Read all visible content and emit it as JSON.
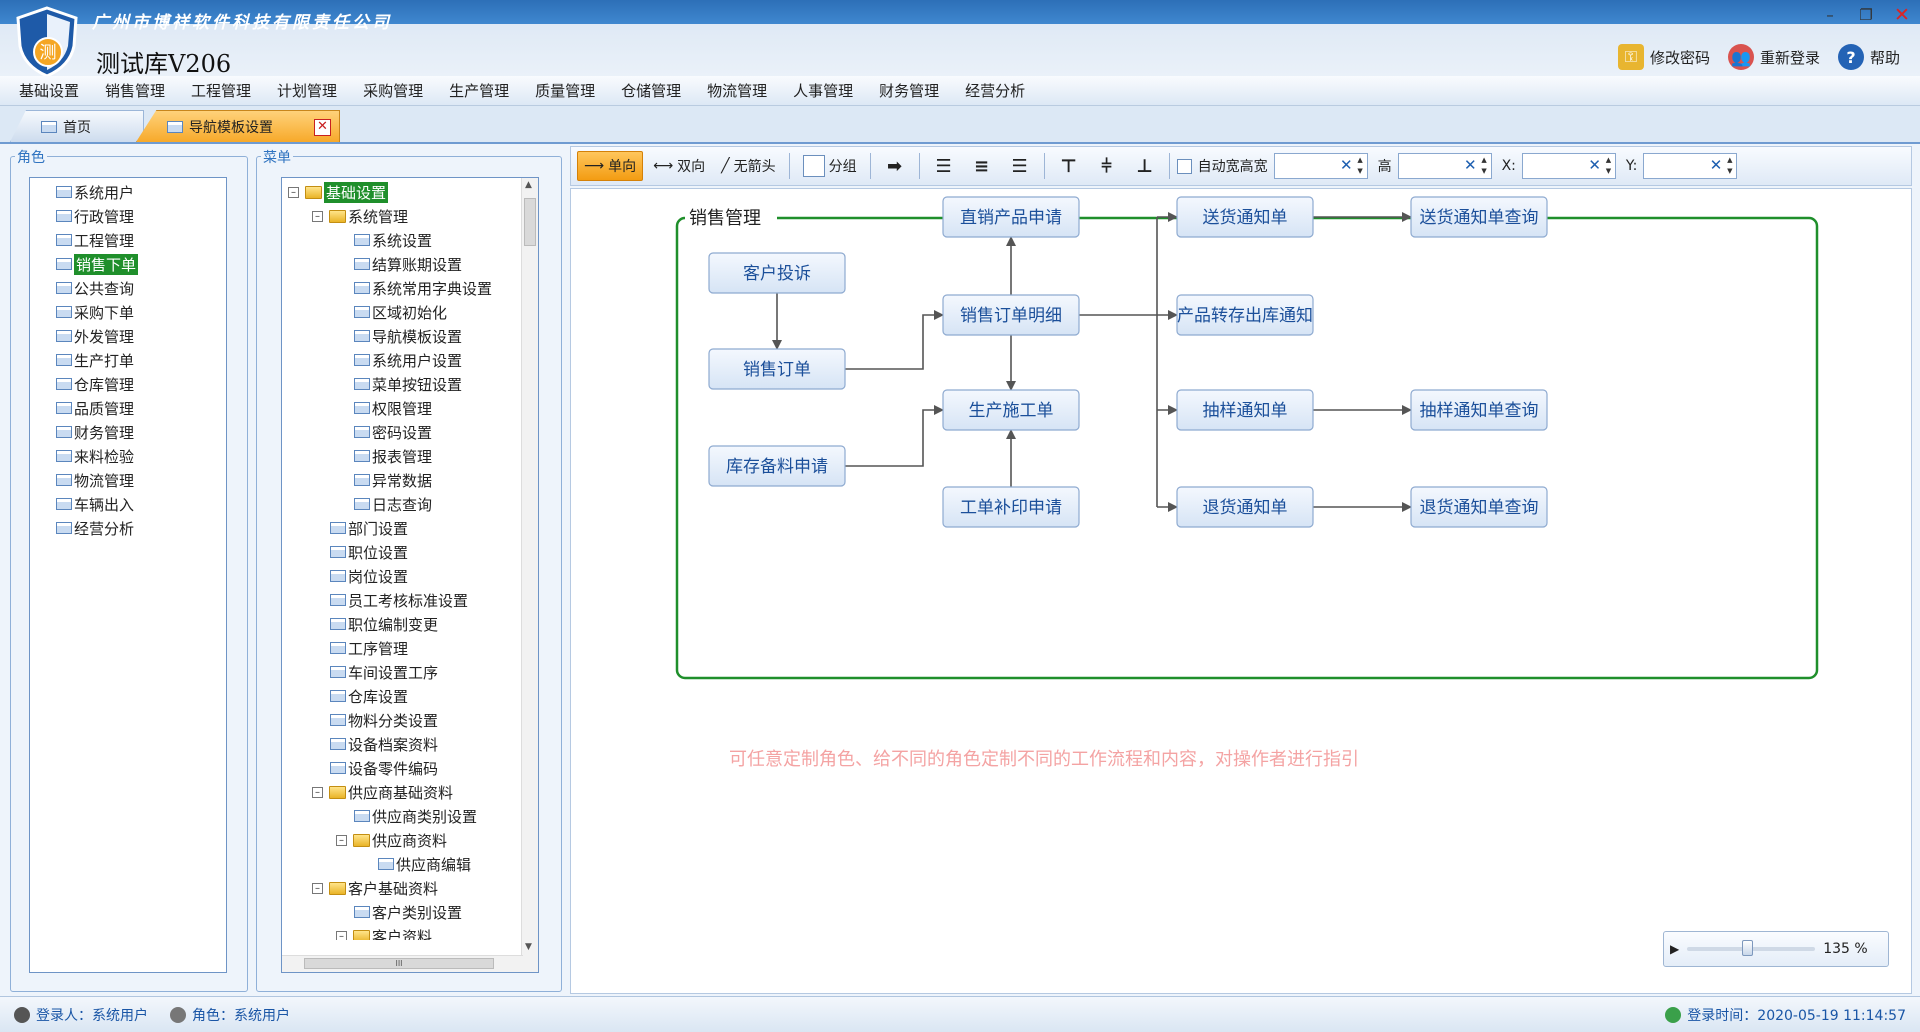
{
  "window": {
    "company": "广州市博祥软件科技有限责任公司",
    "app_name": "测试库V206",
    "logo_char": "测",
    "controls": {
      "minimize": "–",
      "restore": "❐",
      "close": "✕"
    }
  },
  "top_actions": [
    {
      "icon": "key-icon",
      "label": "修改密码"
    },
    {
      "icon": "users-icon",
      "label": "重新登录"
    },
    {
      "icon": "help-icon",
      "label": "帮助"
    }
  ],
  "menu": [
    "基础设置",
    "销售管理",
    "工程管理",
    "计划管理",
    "采购管理",
    "生产管理",
    "质量管理",
    "仓储管理",
    "物流管理",
    "人事管理",
    "财务管理",
    "经营分析"
  ],
  "tabs": [
    {
      "label": "首页"
    },
    {
      "label": "导航模板设置",
      "close": "✕"
    }
  ],
  "roles_panel": {
    "title": "角色",
    "items": [
      "系统用户",
      "行政管理",
      "工程管理",
      "销售下单",
      "公共查询",
      "采购下单",
      "外发管理",
      "生产打单",
      "仓库管理",
      "品质管理",
      "财务管理",
      "来料检验",
      "物流管理",
      "车辆出入",
      "经营分析"
    ],
    "selected": 3
  },
  "menu_panel": {
    "title": "菜单",
    "items": [
      {
        "label": "基础设置",
        "level": 0,
        "type": "folder",
        "expander": "–",
        "selected": true
      },
      {
        "label": "系统管理",
        "level": 1,
        "type": "folder",
        "expander": "–"
      },
      {
        "label": "系统设置",
        "level": 2,
        "type": "page"
      },
      {
        "label": "结算账期设置",
        "level": 2,
        "type": "page"
      },
      {
        "label": "系统常用字典设置",
        "level": 2,
        "type": "page"
      },
      {
        "label": "区域初始化",
        "level": 2,
        "type": "page"
      },
      {
        "label": "导航模板设置",
        "level": 2,
        "type": "page"
      },
      {
        "label": "系统用户设置",
        "level": 2,
        "type": "page"
      },
      {
        "label": "菜单按钮设置",
        "level": 2,
        "type": "page"
      },
      {
        "label": "权限管理",
        "level": 2,
        "type": "page"
      },
      {
        "label": "密码设置",
        "level": 2,
        "type": "page"
      },
      {
        "label": "报表管理",
        "level": 2,
        "type": "page"
      },
      {
        "label": "异常数据",
        "level": 2,
        "type": "page"
      },
      {
        "label": "日志查询",
        "level": 2,
        "type": "page"
      },
      {
        "label": "部门设置",
        "level": 1,
        "type": "page"
      },
      {
        "label": "职位设置",
        "level": 1,
        "type": "page"
      },
      {
        "label": "岗位设置",
        "level": 1,
        "type": "page"
      },
      {
        "label": "员工考核标准设置",
        "level": 1,
        "type": "page"
      },
      {
        "label": "职位编制变更",
        "level": 1,
        "type": "page"
      },
      {
        "label": "工序管理",
        "level": 1,
        "type": "page"
      },
      {
        "label": "车间设置工序",
        "level": 1,
        "type": "page"
      },
      {
        "label": "仓库设置",
        "level": 1,
        "type": "page"
      },
      {
        "label": "物料分类设置",
        "level": 1,
        "type": "page"
      },
      {
        "label": "设备档案资料",
        "level": 1,
        "type": "page"
      },
      {
        "label": "设备零件编码",
        "level": 1,
        "type": "page"
      },
      {
        "label": "供应商基础资料",
        "level": 1,
        "type": "folder",
        "expander": "–"
      },
      {
        "label": "供应商类别设置",
        "level": 2,
        "type": "page"
      },
      {
        "label": "供应商资料",
        "level": 2,
        "type": "folder",
        "expander": "–"
      },
      {
        "label": "供应商编辑",
        "level": 3,
        "type": "page"
      },
      {
        "label": "客户基础资料",
        "level": 1,
        "type": "folder",
        "expander": "–"
      },
      {
        "label": "客户类别设置",
        "level": 2,
        "type": "page"
      },
      {
        "label": "客户资料",
        "level": 2,
        "type": "folder",
        "expander": "–"
      }
    ],
    "scroll_mid": "III"
  },
  "toolbar": {
    "single": "单向",
    "double": "双向",
    "no_arrow": "无箭头",
    "group": "分组",
    "auto_size": "自动宽高宽",
    "height_label": "高",
    "x_label": "X:",
    "y_label": "Y:",
    "clear": "✕",
    "up": "▲",
    "down": "▼"
  },
  "flow": {
    "group_title": "销售管理",
    "nodes": {
      "kehutousu": "客户投诉",
      "xiaoshoudingdan": "销售订单",
      "kucun": "库存备料申请",
      "zhixiao": "直销产品申请",
      "mingxi": "销售订单明细",
      "shigong": "生产施工单",
      "buyin": "工单补印申请",
      "songhuo": "送货通知单",
      "zhuanchu": "产品转存出库通知",
      "chouyang": "抽样通知单",
      "tuihuo": "退货通知单",
      "songhuo_q": "送货通知单查询",
      "chouyang_q": "抽样通知单查询",
      "tuihuo_q": "退货通知单查询"
    },
    "hint": "可任意定制角色、给不同的角色定制不同的工作流程和内容，对操作者进行指引"
  },
  "zoom": {
    "play": "▶",
    "value": "135 %",
    "level_fraction": 0.47
  },
  "status": {
    "login_user": "登录人：系统用户",
    "role": "角色：系统用户",
    "login_time": "登录时间：2020-05-19 11:14:57"
  },
  "colors": {
    "accent": "#1f8f2b",
    "node_text": "#1b4f9a",
    "flow_border": "#1f8f2b"
  }
}
